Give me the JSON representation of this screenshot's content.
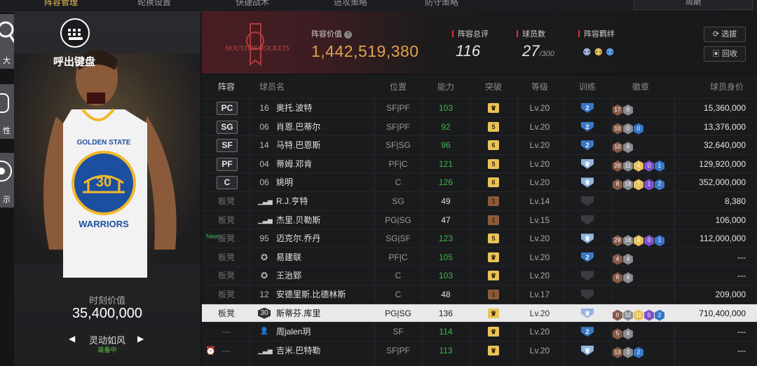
{
  "tabs": [
    {
      "label": "阵容管理",
      "active": true
    },
    {
      "label": "轮换设置",
      "active": false
    },
    {
      "label": "快捷战术",
      "active": false
    },
    {
      "label": "进攻策略",
      "active": false
    },
    {
      "label": "防守策略",
      "active": false
    }
  ],
  "season_select": "周期",
  "keyboard": {
    "label": "呼出键盘"
  },
  "side_buttons": [
    {
      "label": "大"
    },
    {
      "label": "性"
    },
    {
      "label": "示"
    }
  ],
  "player_card": {
    "value_label": "时刻价值",
    "value": "35,400,000",
    "skill_name": "灵动如风",
    "skill_status": "装备中",
    "jersey_text": "GOLDEN STATE",
    "jersey_number": "30",
    "jersey_bottom": "WARRIORS"
  },
  "header": {
    "team_logo_text": "HOUSTON ROCKETS",
    "lineup_value_label": "阵容价值",
    "lineup_value": "1,442,519,380",
    "rating_label": "阵容总评",
    "rating": "116",
    "players_label": "球员数",
    "players": "27",
    "players_max": "/300",
    "bond_label": "阵容羁绊",
    "buttons": {
      "select": "选拔",
      "recycle": "回收"
    }
  },
  "columns": [
    "阵容",
    "球员名",
    "位置",
    "能力",
    "突破",
    "等级",
    "训练",
    "徽章",
    "球员身价"
  ],
  "colors": {
    "gold": "#e8c25a",
    "green": "#3db84a",
    "red": "#d4382e",
    "blue": "#3a77c9"
  },
  "rows": [
    {
      "slot": "PC",
      "starter": true,
      "num": "16",
      "name": "奥托.波特",
      "pos": "SF|PF",
      "ability": "103",
      "ability_color": "green",
      "break": "crown",
      "break_color": "gold",
      "level": "Lv.20",
      "train": "2",
      "train_color": "blue",
      "badges": [
        [
          "17",
          "bronze"
        ],
        [
          "6",
          "silver"
        ]
      ],
      "price": "15,360,000"
    },
    {
      "slot": "SG",
      "starter": true,
      "num": "06",
      "name": "肖恩.巴蒂尔",
      "pos": "SF|PF",
      "ability": "92",
      "ability_color": "green",
      "break": "5",
      "break_color": "gold",
      "level": "Lv.20",
      "train": "2",
      "train_color": "blue",
      "badges": [
        [
          "10",
          "bronze"
        ],
        [
          "0",
          "silver"
        ],
        [
          "0",
          "blue"
        ]
      ],
      "price": "13,376,000"
    },
    {
      "slot": "SF",
      "starter": true,
      "num": "14",
      "name": "马特.巴恩斯",
      "pos": "SF|SG",
      "ability": "96",
      "ability_color": "green",
      "break": "6",
      "break_color": "gold",
      "level": "Lv.20",
      "train": "2",
      "train_color": "blue",
      "badges": [
        [
          "10",
          "bronze"
        ],
        [
          "6",
          "silver"
        ]
      ],
      "price": "32,640,000"
    },
    {
      "slot": "PF",
      "starter": true,
      "num": "04",
      "name": "蒂姆.邓肯",
      "pos": "PF|C",
      "ability": "121",
      "ability_color": "green",
      "break": "5",
      "break_color": "gold",
      "level": "Lv.20",
      "train": "crown",
      "train_color": "lightblue",
      "badges": [
        [
          "26",
          "bronze"
        ],
        [
          "11",
          "silver"
        ],
        [
          "4",
          "gold"
        ],
        [
          "0",
          "purple"
        ],
        [
          "1",
          "blue"
        ]
      ],
      "price": "129,920,000"
    },
    {
      "slot": "C",
      "starter": true,
      "num": "06",
      "name": "姚明",
      "pos": "C",
      "ability": "126",
      "ability_color": "green",
      "break": "6",
      "break_color": "gold",
      "level": "Lv.20",
      "train": "crown",
      "train_color": "lightblue",
      "badges": [
        [
          "8",
          "bronze"
        ],
        [
          "18",
          "silver"
        ],
        [
          "7",
          "gold"
        ],
        [
          "1",
          "purple"
        ],
        [
          "2",
          "blue"
        ]
      ],
      "price": "352,000,000"
    },
    {
      "slot": "板凳",
      "starter": false,
      "num": "bars",
      "name": "R.J.亨特",
      "pos": "SG",
      "ability": "49",
      "ability_color": "white",
      "break": "1",
      "break_color": "brown",
      "level": "Lv.14",
      "train": "",
      "train_color": "gray",
      "badges": [],
      "price": "8,380"
    },
    {
      "slot": "板凳",
      "starter": false,
      "num": "bars",
      "name": "杰里.贝勒斯",
      "pos": "PG|SG",
      "ability": "47",
      "ability_color": "white",
      "break": "1",
      "break_color": "brown",
      "level": "Lv.15",
      "train": "",
      "train_color": "gray",
      "badges": [],
      "price": "106,000"
    },
    {
      "slot": "板凳",
      "starter": false,
      "new": "New",
      "num": "95",
      "name": "迈克尔.乔丹",
      "pos": "SG|SF",
      "ability": "123",
      "ability_color": "green",
      "break": "5",
      "break_color": "gold",
      "level": "Lv.20",
      "train": "crown",
      "train_color": "lightblue",
      "badges": [
        [
          "29",
          "bronze"
        ],
        [
          "16",
          "silver"
        ],
        [
          "4",
          "gold"
        ],
        [
          "0",
          "purple"
        ],
        [
          "1",
          "blue"
        ]
      ],
      "price": "112,000,000"
    },
    {
      "slot": "板凳",
      "starter": false,
      "num": "star",
      "name": "易建联",
      "pos": "PF|C",
      "ability": "105",
      "ability_color": "green",
      "break": "crown",
      "break_color": "gold",
      "level": "Lv.20",
      "train": "2",
      "train_color": "blue",
      "badges": [
        [
          "4",
          "bronze"
        ],
        [
          "4",
          "silver"
        ]
      ],
      "price": "---"
    },
    {
      "slot": "板凳",
      "starter": false,
      "num": "star",
      "name": "王治郅",
      "pos": "C",
      "ability": "103",
      "ability_color": "green",
      "break": "crown",
      "break_color": "gold",
      "level": "Lv.20",
      "train": "",
      "train_color": "gray",
      "badges": [
        [
          "6",
          "bronze"
        ],
        [
          "4",
          "silver"
        ]
      ],
      "price": "---"
    },
    {
      "slot": "板凳",
      "starter": false,
      "num": "12",
      "name": "安德里斯.比德林斯",
      "pos": "C",
      "ability": "48",
      "ability_color": "white",
      "break": "1",
      "break_color": "brown",
      "level": "Lv.17",
      "train": "",
      "train_color": "gray",
      "badges": [],
      "price": "209,000"
    },
    {
      "slot": "板凳",
      "starter": false,
      "selected": true,
      "num": "30",
      "name": "斯蒂芬.库里",
      "pos": "PG|SG",
      "ability": "136",
      "ability_color": "dark",
      "break": "crown",
      "break_color": "gold",
      "level": "Lv.20",
      "train": "crown",
      "train_color": "lightblue",
      "badges": [
        [
          "0",
          "bronze"
        ],
        [
          "32",
          "silver"
        ],
        [
          "11",
          "gold"
        ],
        [
          "5",
          "purple"
        ],
        [
          "2",
          "blue"
        ]
      ],
      "price": "710,400,000"
    },
    {
      "slot": "---",
      "starter": false,
      "num": "person",
      "name": "周jalen玥",
      "pos": "SF",
      "ability": "114",
      "ability_color": "green",
      "break": "crown",
      "break_color": "gold",
      "level": "Lv.20",
      "train": "2",
      "train_color": "blue",
      "badges": [
        [
          "5",
          "bronze"
        ],
        [
          "4",
          "silver"
        ]
      ],
      "price": "---"
    },
    {
      "slot": "---",
      "starter": false,
      "alarm": true,
      "num": "bars",
      "name": "吉米.巴特勒",
      "pos": "SF|PF",
      "ability": "113",
      "ability_color": "green",
      "break": "crown",
      "break_color": "gold",
      "level": "Lv.20",
      "train": "crown",
      "train_color": "lightblue",
      "badges": [
        [
          "13",
          "bronze"
        ],
        [
          "3",
          "silver"
        ],
        [
          "2",
          "blue"
        ]
      ],
      "price": "---"
    }
  ]
}
